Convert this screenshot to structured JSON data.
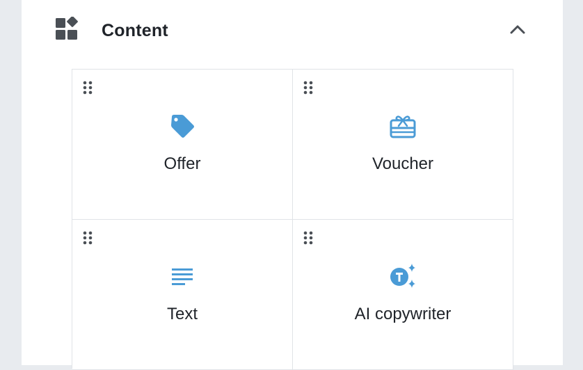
{
  "section": {
    "title": "Content",
    "icon": "widgets-icon",
    "collapse_icon": "chevron-up-icon"
  },
  "colors": {
    "accent": "#4a9bd6",
    "icon_dark": "#4a4f55",
    "border": "#e0e3e7",
    "background": "#e8ebef"
  },
  "tiles": [
    {
      "label": "Offer",
      "icon": "tag-icon"
    },
    {
      "label": "Voucher",
      "icon": "gift-card-icon"
    },
    {
      "label": "Text",
      "icon": "text-lines-icon"
    },
    {
      "label": "AI copywriter",
      "icon": "ai-sparkle-icon"
    }
  ]
}
